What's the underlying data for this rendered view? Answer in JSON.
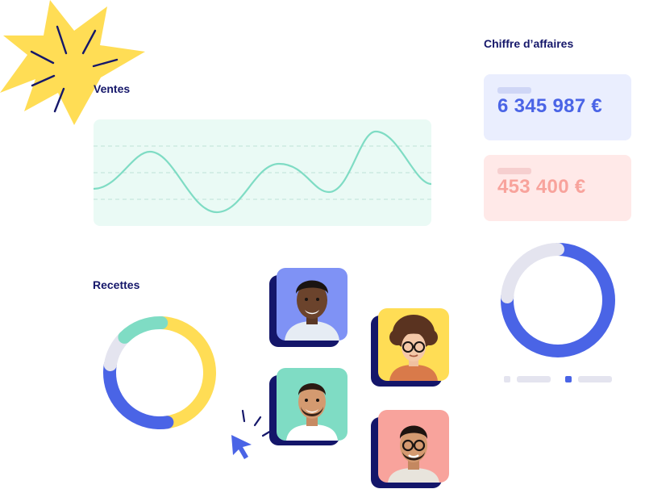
{
  "sections": {
    "ventes_title": "Ventes",
    "chiffre_affaires_title": "Chiffre d’affaires",
    "recettes_title": "Recettes"
  },
  "cards": {
    "revenue_value": "6 345 987 €",
    "secondary_value": "453 400 €"
  },
  "colors": {
    "navy": "#15176a",
    "blue": "#4a64e6",
    "mint": "#7fdcc4",
    "yellow": "#ffdd55",
    "coral": "#f8a39c",
    "light_gray": "#e4e4ef"
  },
  "recettes_donut": {
    "segments": [
      {
        "color": "#ffdd55",
        "fraction": 0.47
      },
      {
        "color": "#4a64e6",
        "fraction": 0.3
      },
      {
        "color": "#e4e4ef",
        "fraction": 0.1
      },
      {
        "color": "#7fdcc4",
        "fraction": 0.13
      }
    ]
  },
  "ca_donut": {
    "segments": [
      {
        "color": "#4a64e6",
        "fraction": 0.76
      },
      {
        "color": "#e4e4ef",
        "fraction": 0.24
      }
    ]
  },
  "people": [
    {
      "name": "person-1",
      "bg": "#7f92f5"
    },
    {
      "name": "person-2",
      "bg": "#ffdd55"
    },
    {
      "name": "person-3",
      "bg": "#7fdcc4"
    },
    {
      "name": "person-4",
      "bg": "#f8a39c"
    }
  ],
  "icons": [
    "starburst-icon",
    "cursor-icon",
    "click-burst-icon"
  ]
}
